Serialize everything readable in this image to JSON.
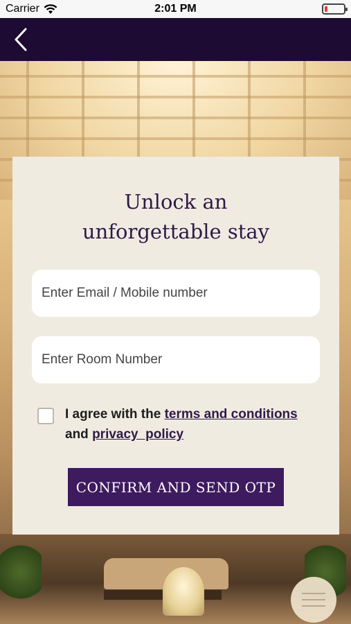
{
  "status_bar": {
    "carrier": "Carrier",
    "time": "2:01 PM",
    "battery_level": 0.15,
    "battery_color": "#e23b3b"
  },
  "nav_bar": {
    "background": "#1e0b33",
    "back_icon": "chevron-left-icon"
  },
  "card": {
    "title_line1": "Unlock an",
    "title_line2": "unforgettable stay",
    "email_placeholder": "Enter Email / Mobile number",
    "room_placeholder": "Enter Room Number",
    "agree_prefix": "I agree with the ",
    "terms_link": "terms and conditions",
    "agree_middle": "and ",
    "privacy_link": "privacy  policy",
    "agree_checked": false,
    "confirm_label": "CONFIRM AND SEND OTP",
    "confirm_color": "#3e1a5e"
  },
  "menu_fab": {
    "icon": "hamburger-menu-icon"
  }
}
